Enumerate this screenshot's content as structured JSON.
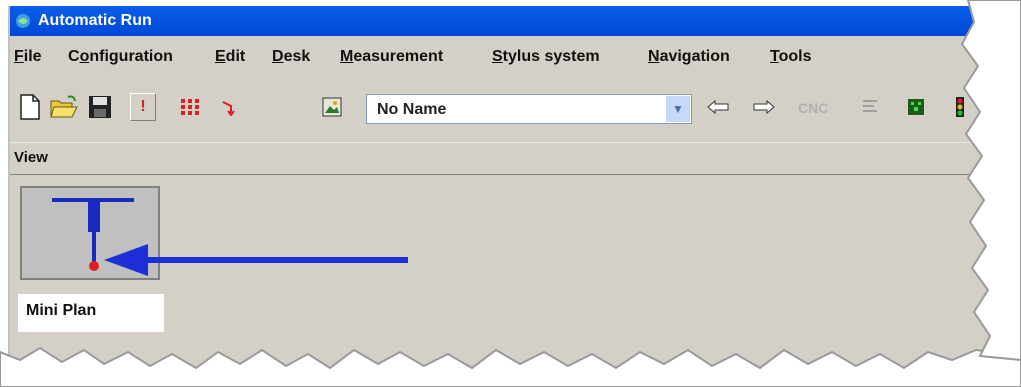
{
  "window": {
    "title": "Automatic Run"
  },
  "menu": [
    {
      "label": "File",
      "mnemonic": "F",
      "rest": "ile"
    },
    {
      "label": "Configuration",
      "mnemonic": "o",
      "prefix": "C",
      "rest": "nfiguration"
    },
    {
      "label": "Edit",
      "mnemonic": "E",
      "rest": "dit"
    },
    {
      "label": "Desk",
      "mnemonic": "D",
      "rest": "esk"
    },
    {
      "label": "Measurement",
      "mnemonic": "M",
      "rest": "easurement"
    },
    {
      "label": "Stylus system",
      "mnemonic": "S",
      "rest": "tylus system"
    },
    {
      "label": "Navigation",
      "mnemonic": "N",
      "rest": "avigation"
    },
    {
      "label": "Tools",
      "mnemonic": "T",
      "rest": "ools"
    }
  ],
  "toolbar": {
    "icons": [
      "new-document-icon",
      "open-folder-icon",
      "save-disk-icon",
      "stop-icon",
      "grid-icon",
      "path-arrow-icon",
      "image-icon"
    ],
    "combo_value": "No Name",
    "nav": [
      "back-arrow-icon",
      "forward-arrow-icon"
    ],
    "cnc_label": "CNC",
    "extra_icons": [
      "list-icon",
      "green-board-icon",
      "traffic-light-icon"
    ]
  },
  "view": {
    "label": "View"
  },
  "mini_plan": {
    "label": "Mini Plan",
    "icon": "probe-stylus-icon"
  },
  "colors": {
    "titlebar": "#0a5ee8",
    "window_bg": "#d4d0c8",
    "arrow": "#1f2fd8",
    "stylus": "#1a2ac0",
    "probe_tip": "#e02020"
  }
}
